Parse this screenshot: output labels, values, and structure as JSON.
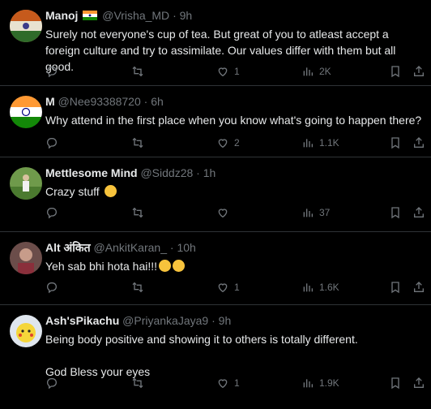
{
  "tweets": [
    {
      "name": "Manoj",
      "handle": "@Vrisha_MD",
      "dot": "·",
      "time": "9h",
      "text": "Surely not everyone's cup of tea. But great of you to atleast accept a foreign culture and try to assimilate. Our values differ with them but all good.",
      "likes": "1",
      "views": "2K",
      "flag": true
    },
    {
      "name": "M",
      "handle": "@Nee93388720",
      "dot": "·",
      "time": "6h",
      "text": "Why attend in the first place when you know what's going to happen there?",
      "likes": "2",
      "views": "1.1K"
    },
    {
      "name": "Mettlesome Mind",
      "handle": "@Siddz28",
      "dot": "·",
      "time": "1h",
      "text": "Crazy stuff",
      "likes": "",
      "views": "37",
      "emojis": [
        "laughing-crying"
      ]
    },
    {
      "name": "Alt अंकित",
      "handle": "@AnkitKaran_",
      "dot": "·",
      "time": "10h",
      "text": "Yeh sab bhi hota hai!!!",
      "likes": "1",
      "views": "1.6K",
      "emojis": [
        "flushed",
        "astonished"
      ]
    },
    {
      "name": "Ash'sPikachu",
      "handle": "@PriyankaJaya9",
      "dot": "·",
      "time": "9h",
      "text": "Being body positive and showing it to others is totally different.\n\nGod Bless your eyes",
      "likes": "1",
      "views": "1.9K"
    }
  ],
  "colors": {
    "background": "#000000",
    "text": "#e7e9ea",
    "muted": "#71767b",
    "divider": "#2f3336"
  },
  "icons": [
    "reply-icon",
    "retweet-icon",
    "like-icon",
    "views-icon",
    "bookmark-icon",
    "share-icon"
  ]
}
